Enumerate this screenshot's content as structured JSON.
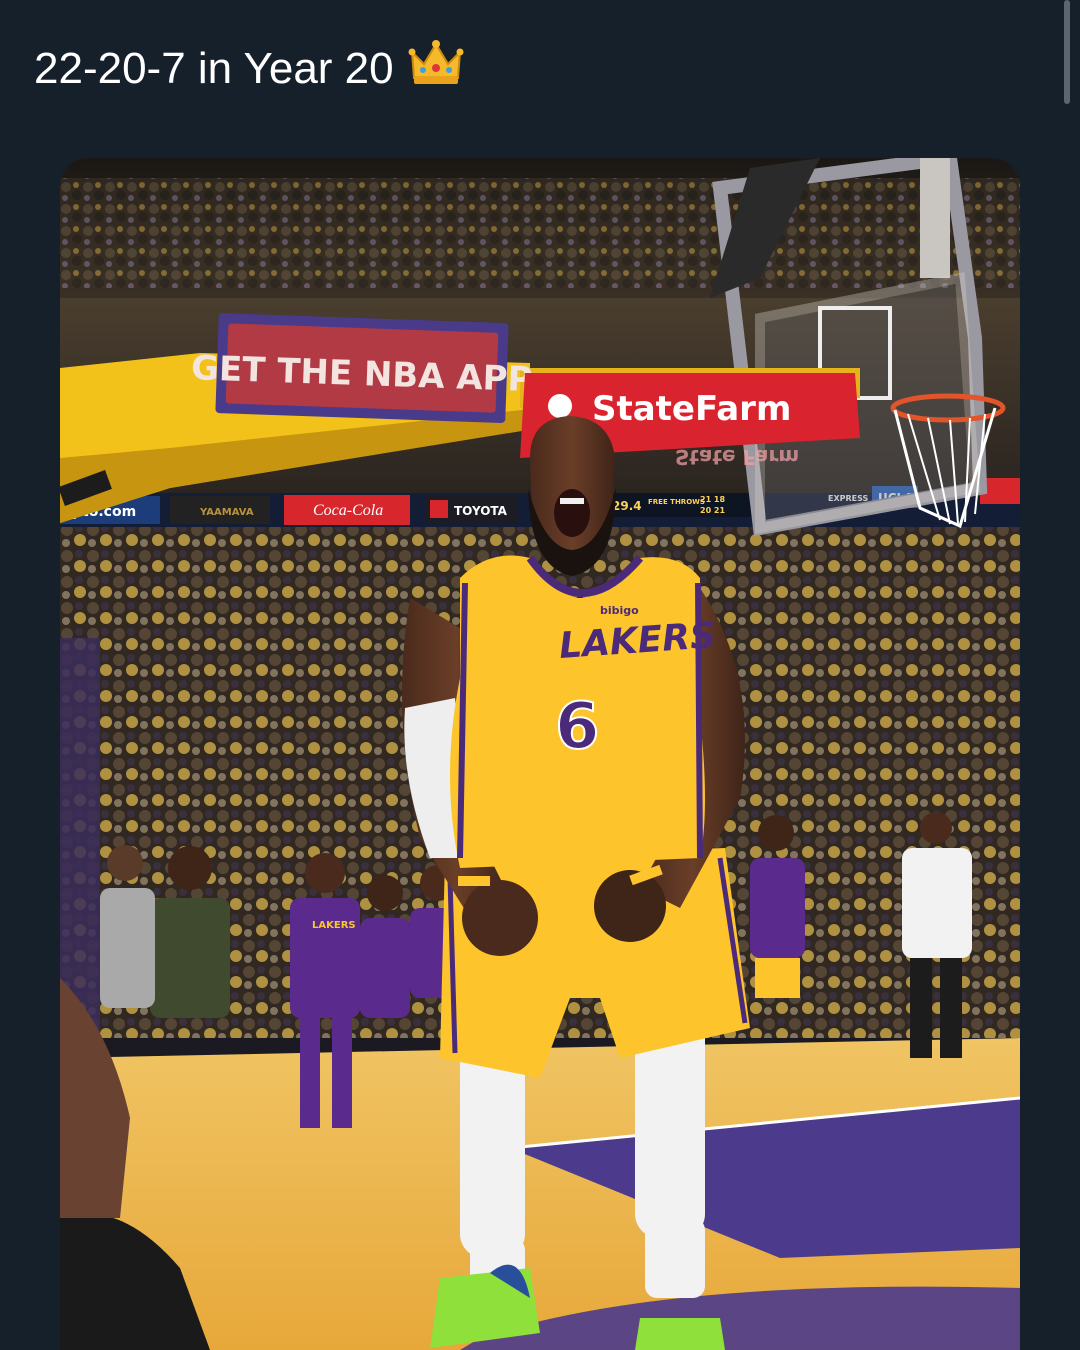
{
  "post": {
    "text": "22-20-7 in Year 20",
    "emoji": "crown-emoji"
  },
  "photo": {
    "signs": {
      "app_banner": "GET THE NBA APP",
      "sponsor": "StateFarm",
      "sponsor_mirror": "State Farm",
      "coke": "Coca-Cola",
      "toyota": "TOYOTA",
      "ucla": "UCLA",
      "crypto": "pto.com",
      "yaamava": "YAAMAVA",
      "express": "EXPRESS",
      "shot_clock": "29.4",
      "free_throws": "FREE THROWS",
      "score_a": "21 18",
      "score_b": "20 21"
    },
    "jersey": {
      "team": "LAKERS",
      "number": "6",
      "patch": "bibigo",
      "bench_team": "LAKERS"
    },
    "colors": {
      "lakers_gold": "#fdc42c",
      "lakers_purple": "#4b2a7a",
      "court_gold": "#e9a72a",
      "stanchion_yellow": "#f2c21b",
      "statefarm_red": "#d9232e"
    }
  }
}
